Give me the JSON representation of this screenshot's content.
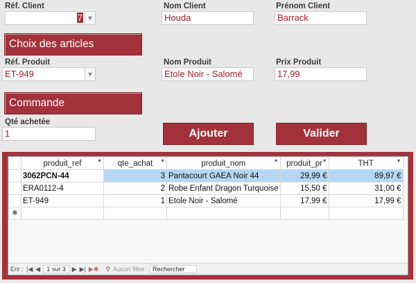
{
  "client": {
    "ref_label": "Réf. Client",
    "ref_value": "7",
    "nom_label": "Nom Client",
    "nom_value": "Houda",
    "prenom_label": "Prénom Client",
    "prenom_value": "Barrack"
  },
  "section_articles": "Choix des articles",
  "produit": {
    "ref_label": "Réf. Produit",
    "ref_value": "ET-949",
    "nom_label": "Nom Produit",
    "nom_value": "Etole Noir - Salomé",
    "prix_label": "Prix Produit",
    "prix_value": "17,99"
  },
  "section_commande": "Commande",
  "qte": {
    "label": "Qté achetée",
    "value": "1"
  },
  "buttons": {
    "ajouter": "Ajouter",
    "valider": "Valider"
  },
  "grid": {
    "headers": [
      "produit_ref",
      "qte_achat",
      "produit_nom",
      "produit_pr",
      "THT"
    ],
    "rows": [
      [
        "3062PCN-44",
        "3",
        "Pantacourt GAEA Noir 44",
        "29,99 €",
        "89,97 €"
      ],
      [
        "ERA0112-4",
        "2",
        "Robe Enfant Dragon Turquoise",
        "15,50 €",
        "31,00 €"
      ],
      [
        "ET-949",
        "1",
        "Etole Noir - Salomé",
        "17,99 €",
        "17,99 €"
      ]
    ],
    "new_row_marker": "✱"
  },
  "navigation": {
    "label": "Enr :",
    "record": "1 sur 3",
    "filter": "Aucun filtre",
    "search": "Rechercher"
  },
  "colors": {
    "accent": "#a3323a",
    "value_text": "#a11d2a",
    "highlight": "#b5d7f4"
  }
}
